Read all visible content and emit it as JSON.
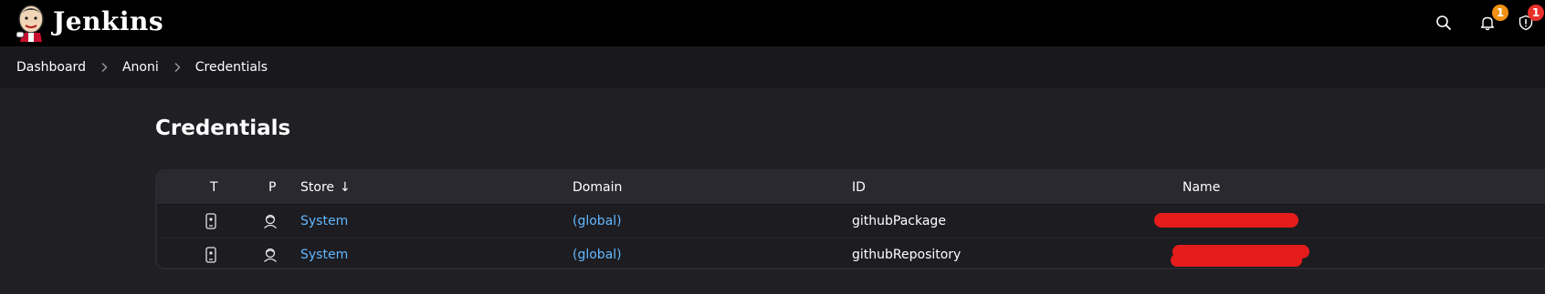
{
  "header": {
    "brand": "Jenkins",
    "notifications_badge": "1",
    "security_badge": "1",
    "colors": {
      "notification": "#f29111",
      "security": "#e8302a",
      "link": "#63b8ff"
    }
  },
  "breadcrumb": {
    "items": [
      "Dashboard",
      "Anoni",
      "Credentials"
    ]
  },
  "page": {
    "title": "Credentials"
  },
  "table": {
    "columns": {
      "t": "T",
      "p": "P",
      "store": "Store",
      "sort_indicator": "↓",
      "domain": "Domain",
      "id": "ID",
      "name": "Name"
    },
    "rows": [
      {
        "type_icon": "mobile-credential-icon",
        "provider_icon": "user-provider-icon",
        "store": "System",
        "domain": "(global)",
        "id": "githubPackage",
        "name_redacted": true
      },
      {
        "type_icon": "mobile-credential-icon",
        "provider_icon": "user-provider-icon",
        "store": "System",
        "domain": "(global)",
        "id": "githubRepository",
        "name_redacted": true
      }
    ]
  }
}
